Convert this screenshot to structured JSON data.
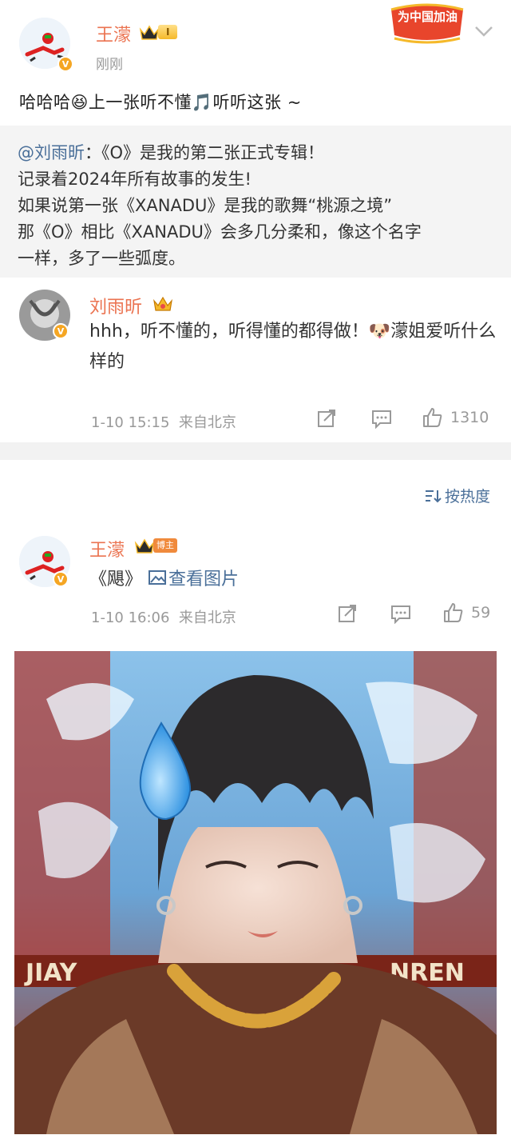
{
  "post": {
    "author": "王濛",
    "time": "刚刚",
    "level_badge": "I",
    "event_badge": "为中国加油",
    "text": "哈哈哈😆上一张听不懂🎵听听这张 ~"
  },
  "quote": {
    "mention": "@刘雨昕",
    "lines": [
      "：《O》是我的第二张正式专辑！",
      "记录着2024年所有故事的发生!",
      "如果说第一张《XANADU》是我的歌舞“桃源之境”",
      "那《O》相比《XANADU》会多几分柔和，像这个名字",
      "一样，多了一些弧度。"
    ]
  },
  "reply": {
    "author": "刘雨昕",
    "text": "hhh，听不懂的，听得懂的都得做！🐶濛姐爱听什么样的",
    "time": "1-10 15:15",
    "source": "来自北京",
    "likes": "1310"
  },
  "sort": {
    "label": "按热度"
  },
  "comment": {
    "author": "王濛",
    "badge": "博主",
    "text": "《飓》",
    "view_image": "查看图片",
    "time": "1-10 16:06",
    "source": "来自北京",
    "likes": "59"
  },
  "photo": {
    "banner_left": "JIAY",
    "banner_right": "NREN"
  }
}
